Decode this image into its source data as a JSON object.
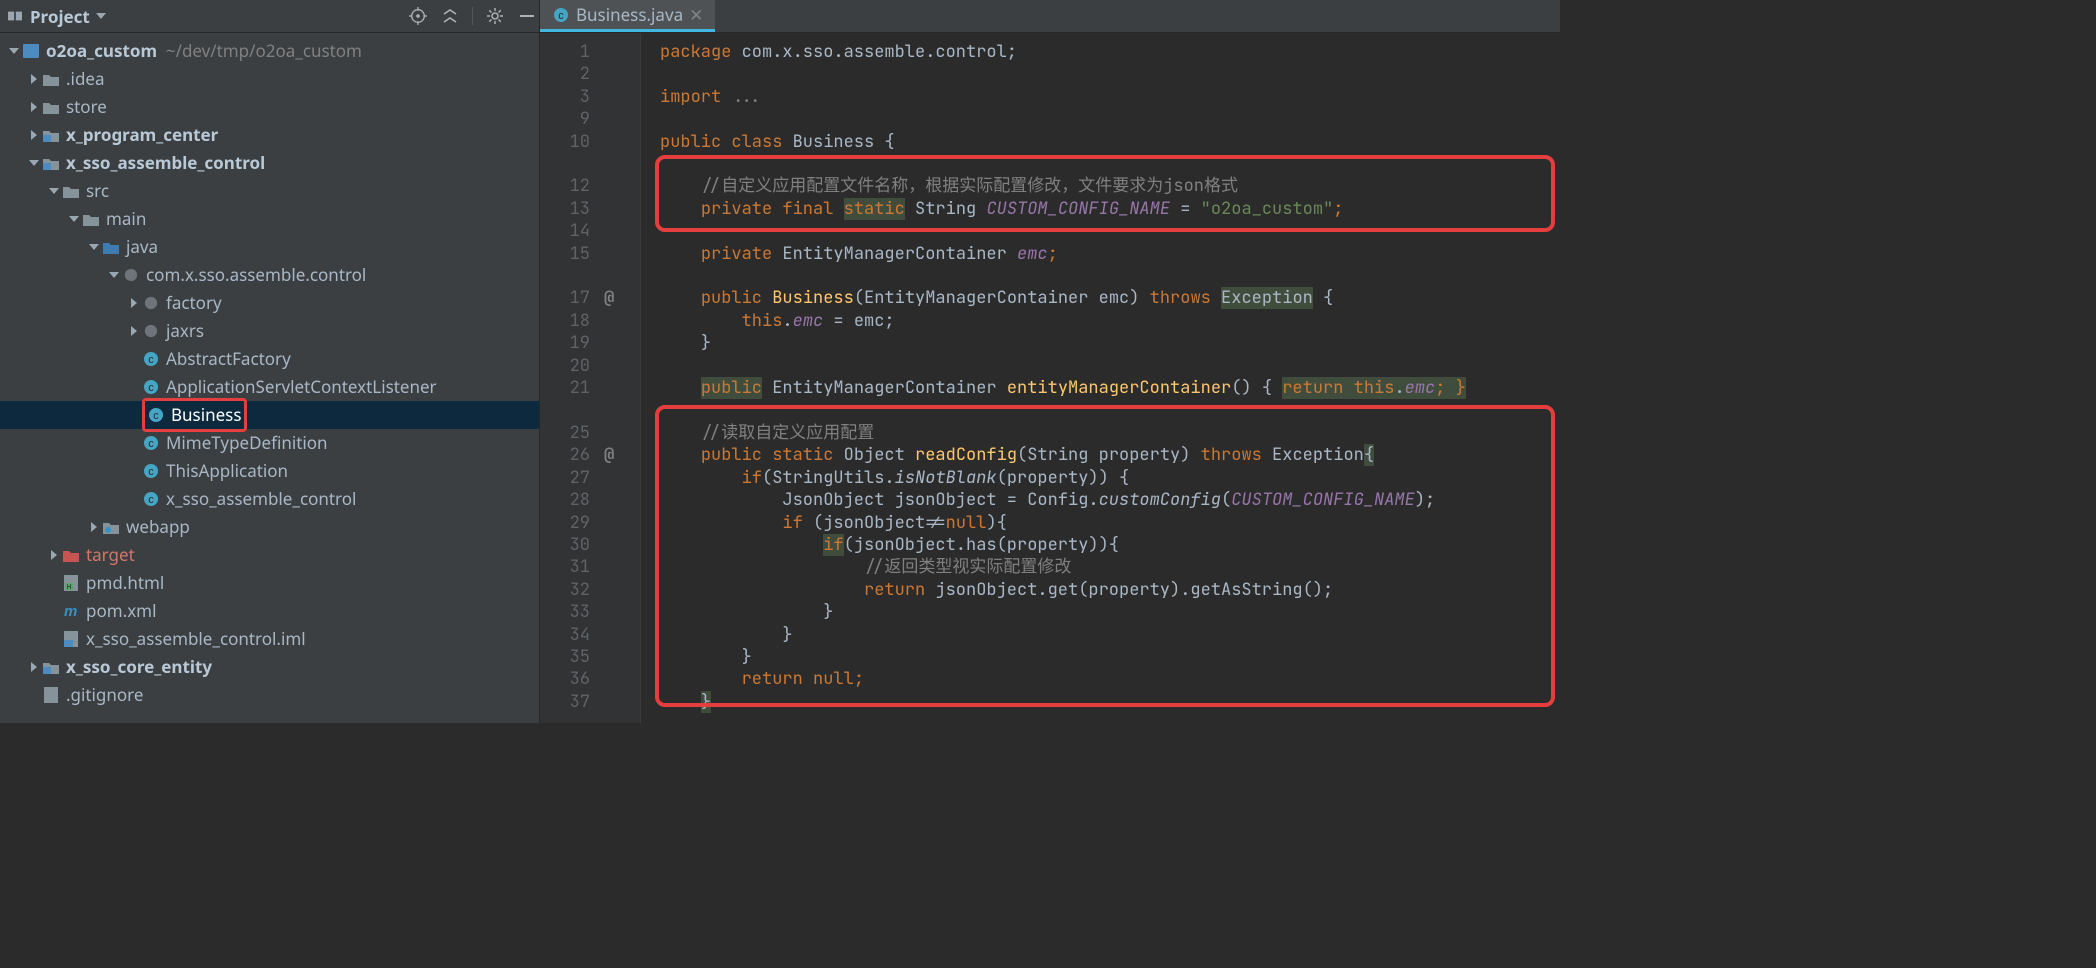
{
  "sidebar": {
    "title": "Project",
    "root_label": "o2oa_custom",
    "root_path": "~/dev/tmp/o2oa_custom",
    "items": {
      "idea": ".idea",
      "store": "store",
      "xpc": "x_program_center",
      "xsac": "x_sso_assemble_control",
      "src": "src",
      "main": "main",
      "java": "java",
      "pkg": "com.x.sso.assemble.control",
      "factory": "factory",
      "jaxrs": "jaxrs",
      "abstractfactory": "AbstractFactory",
      "appservlet": "ApplicationServletContextListener",
      "business": "Business",
      "mimetype": "MimeTypeDefinition",
      "thisapp": "ThisApplication",
      "xsac_class": "x_sso_assemble_control",
      "webapp": "webapp",
      "target": "target",
      "pmd": "pmd.html",
      "pom": "pom.xml",
      "iml": "x_sso_assemble_control.iml",
      "xsce": "x_sso_core_entity",
      "gitignore": ".gitignore"
    }
  },
  "tab": {
    "label": "Business.java"
  },
  "gutter_lines": [
    "1",
    "2",
    "3",
    "9",
    "10",
    "",
    "12",
    "13",
    "14",
    "15",
    "",
    "17",
    "18",
    "19",
    "20",
    "21",
    "",
    "25",
    "26",
    "27",
    "28",
    "29",
    "30",
    "31",
    "32",
    "33",
    "34",
    "35",
    "36",
    "37"
  ],
  "code": {
    "l1_a": "package",
    "l1_b": " com.x.sso.assemble.control;",
    "l3_a": "import",
    "l3_b": " ...",
    "l5_a": "public class",
    "l5_b": " Business {",
    "l7": "//自定义应用配置文件名称，根据实际配置修改，文件要求为json格式",
    "l8_a": "private final ",
    "l8_b": "static",
    "l8_c": " String ",
    "l8_d": "CUSTOM_CONFIG_NAME",
    "l8_e": " = ",
    "l8_f": "\"o2oa_custom\"",
    "l8_g": ";",
    "l10_a": "private",
    "l10_b": " EntityManagerContainer ",
    "l10_c": "emc",
    "l10_d": ";",
    "l12_a": "public ",
    "l12_b": "Business",
    "l12_c": "(EntityManagerContainer emc) ",
    "l12_d": "throws ",
    "l12_e": "Exception",
    "l12_f": " {",
    "l13_a": "this",
    "l13_b": ".",
    "l13_c": "emc",
    "l13_d": " = emc;",
    "l14": "}",
    "l16_a": "public",
    "l16_b": " EntityManagerContainer ",
    "l16_c": "entityManagerContainer",
    "l16_d": "() { ",
    "l16_e": "return ",
    "l16_f": "this",
    "l16_g": ".",
    "l16_h": "emc",
    "l16_i": "; }",
    "l18": "//读取自定义应用配置",
    "l19_a": "public static",
    "l19_b": " Object ",
    "l19_c": "readConfig",
    "l19_d": "(String property) ",
    "l19_e": "throws",
    "l19_f": " Exception",
    "l19_g": "{",
    "l20_a": "if",
    "l20_b": "(StringUtils.",
    "l20_c": "isNotBlank",
    "l20_d": "(property)) {",
    "l21_a": "JsonObject jsonObject = Config.",
    "l21_b": "customConfig",
    "l21_c": "(",
    "l21_d": "CUSTOM_CONFIG_NAME",
    "l21_e": ");",
    "l22_a": "if ",
    "l22_b": "(jsonObject!=",
    "l22_c": "null",
    "l22_d": "){",
    "l23_a": "if",
    "l23_b": "(jsonObject.has(property)){",
    "l24": "//返回类型视实际配置修改",
    "l25_a": "return",
    "l25_b": " jsonObject.get(property).getAsString();",
    "l26": "}",
    "l27": "}",
    "l28": "}",
    "l29_a": "return ",
    "l29_b": "null",
    "l29_c": ";",
    "l30": "}"
  }
}
